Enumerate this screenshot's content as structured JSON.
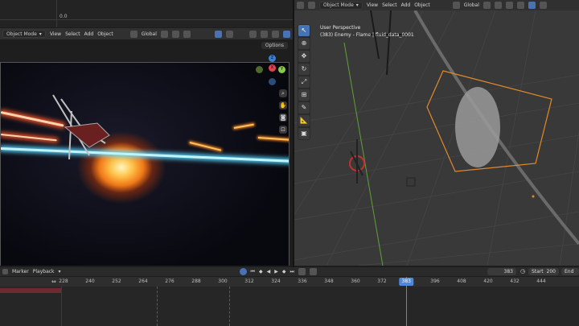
{
  "graph_editor": {
    "zero_label": "0.0"
  },
  "left_view": {
    "mode_label": "Object Mode",
    "menus": [
      "View",
      "Select",
      "Add",
      "Object"
    ],
    "transform_orientation": "Global",
    "options_label": "Options",
    "gizmo_axes": {
      "z": "Z",
      "x": "X",
      "y": "Y"
    }
  },
  "right_view": {
    "mode_label": "Object Mode",
    "menus": [
      "View",
      "Select",
      "Add",
      "Object"
    ],
    "transform_orientation": "Global",
    "perspective_label": "User Perspective",
    "object_label": "(383) Enemy - Flame | fluid_data_0001"
  },
  "timeline": {
    "menus": [
      "Marker",
      "Playback"
    ],
    "current_frame": "383",
    "start_label": "Start",
    "start_value": "200",
    "end_label": "End",
    "ticks": [
      "228",
      "240",
      "252",
      "264",
      "276",
      "288",
      "300",
      "312",
      "324",
      "336",
      "348",
      "360",
      "372",
      "384",
      "396",
      "408",
      "420",
      "432",
      "444"
    ],
    "playhead_label": "383",
    "playhead_frame": 383,
    "first_tick_frame": 228
  },
  "colors": {
    "accent": "#4772b3",
    "playhead": "#4f87e0",
    "selection_outline": "#e08a2a"
  }
}
